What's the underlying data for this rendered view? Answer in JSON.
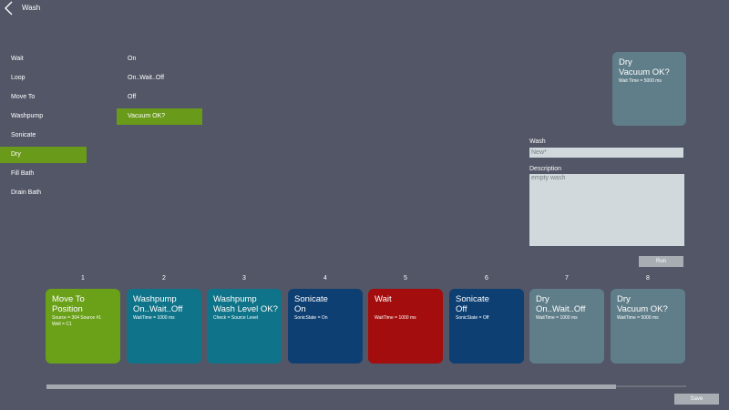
{
  "header": {
    "title": "Wash",
    "back_icon": "chevron-left-icon"
  },
  "categories": [
    "Wait",
    "Loop",
    "Move To",
    "Washpump",
    "Sonicate",
    "Dry",
    "Fill Bath",
    "Drain Bath"
  ],
  "selected_category": "Dry",
  "options": [
    "On",
    "On..Wait..Off",
    "Off",
    "Vacuum OK?"
  ],
  "selected_option": "Vacuum OK?",
  "preview": {
    "line1": "Dry",
    "line2": "Vacuum OK?",
    "desc": "Wait Time = 5000 ms",
    "color": "#5f7e89"
  },
  "form": {
    "wash_label": "Wash",
    "wash_value": "New*",
    "description_label": "Description",
    "description_value": "empty wash",
    "run_label": "Run",
    "save_label": "Save"
  },
  "steps": [
    {
      "number": "1",
      "line1": "Move To",
      "line2": "Position",
      "desc1": "Source = 304 Source #1",
      "desc2": "Well = C1",
      "color": "#6aa118"
    },
    {
      "number": "2",
      "line1": "Washpump",
      "line2": "On..Wait..Off",
      "desc1": "WaitTime = 1000 ms",
      "desc2": "",
      "color": "#0f7489"
    },
    {
      "number": "3",
      "line1": "Washpump",
      "line2": "Wash Level OK?",
      "desc1": "Check = Source Level",
      "desc2": "",
      "color": "#0f7489"
    },
    {
      "number": "4",
      "line1": "Sonicate",
      "line2": "On",
      "desc1": "SonicState = On",
      "desc2": "",
      "color": "#0e3f72"
    },
    {
      "number": "5",
      "line1": "Wait",
      "line2": "",
      "desc1": "WaitTime = 1000 ms",
      "desc2": "",
      "color": "#a40d0d"
    },
    {
      "number": "6",
      "line1": "Sonicate",
      "line2": "Off",
      "desc1": "SonicState = Off",
      "desc2": "",
      "color": "#0e3f72"
    },
    {
      "number": "7",
      "line1": "Dry",
      "line2": "On..Wait..Off",
      "desc1": "WaitTime = 1000 ms",
      "desc2": "",
      "color": "#5f7e89"
    },
    {
      "number": "8",
      "line1": "Dry",
      "line2": "Vacuum OK?",
      "desc1": "WaitTime = 5000 ms",
      "desc2": "",
      "color": "#5f7e89"
    }
  ],
  "scroll": {
    "visible_fraction": 0.89
  },
  "colors": {
    "background": "#525666",
    "selection": "#6a9a1a"
  }
}
